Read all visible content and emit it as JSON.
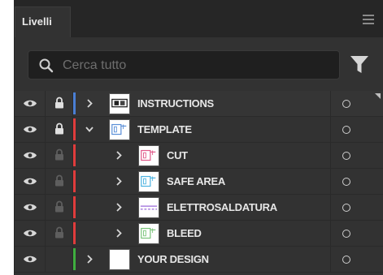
{
  "panel": {
    "tab_label": "Livelli",
    "menu_icon": "hamburger-menu-icon"
  },
  "search": {
    "placeholder": "Cerca tutto",
    "value": "",
    "icon": "search-icon",
    "filter_icon": "filter-icon"
  },
  "layers": [
    {
      "name": "INSTRUCTIONS",
      "color": "#4a7fd4",
      "visible": true,
      "locked": true,
      "lock_dim": false,
      "expanded": false,
      "indent": 0,
      "thumb": "instructions"
    },
    {
      "name": "TEMPLATE",
      "color": "#e03c3c",
      "visible": true,
      "locked": true,
      "lock_dim": false,
      "expanded": true,
      "indent": 0,
      "thumb": "template"
    },
    {
      "name": "CUT",
      "color": "#e03c3c",
      "visible": true,
      "locked": true,
      "lock_dim": true,
      "expanded": false,
      "indent": 1,
      "thumb": "cut"
    },
    {
      "name": "SAFE AREA",
      "color": "#e03c3c",
      "visible": true,
      "locked": true,
      "lock_dim": true,
      "expanded": false,
      "indent": 1,
      "thumb": "safe"
    },
    {
      "name": "ELETTROSALDATURA",
      "color": "#e03c3c",
      "visible": true,
      "locked": true,
      "lock_dim": true,
      "expanded": false,
      "indent": 1,
      "thumb": "elettro"
    },
    {
      "name": "BLEED",
      "color": "#e03c3c",
      "visible": true,
      "locked": true,
      "lock_dim": true,
      "expanded": false,
      "indent": 1,
      "thumb": "bleed"
    },
    {
      "name": "YOUR DESIGN",
      "color": "#3fae3f",
      "visible": true,
      "locked": false,
      "lock_dim": false,
      "expanded": false,
      "indent": 0,
      "thumb": "blank"
    }
  ]
}
